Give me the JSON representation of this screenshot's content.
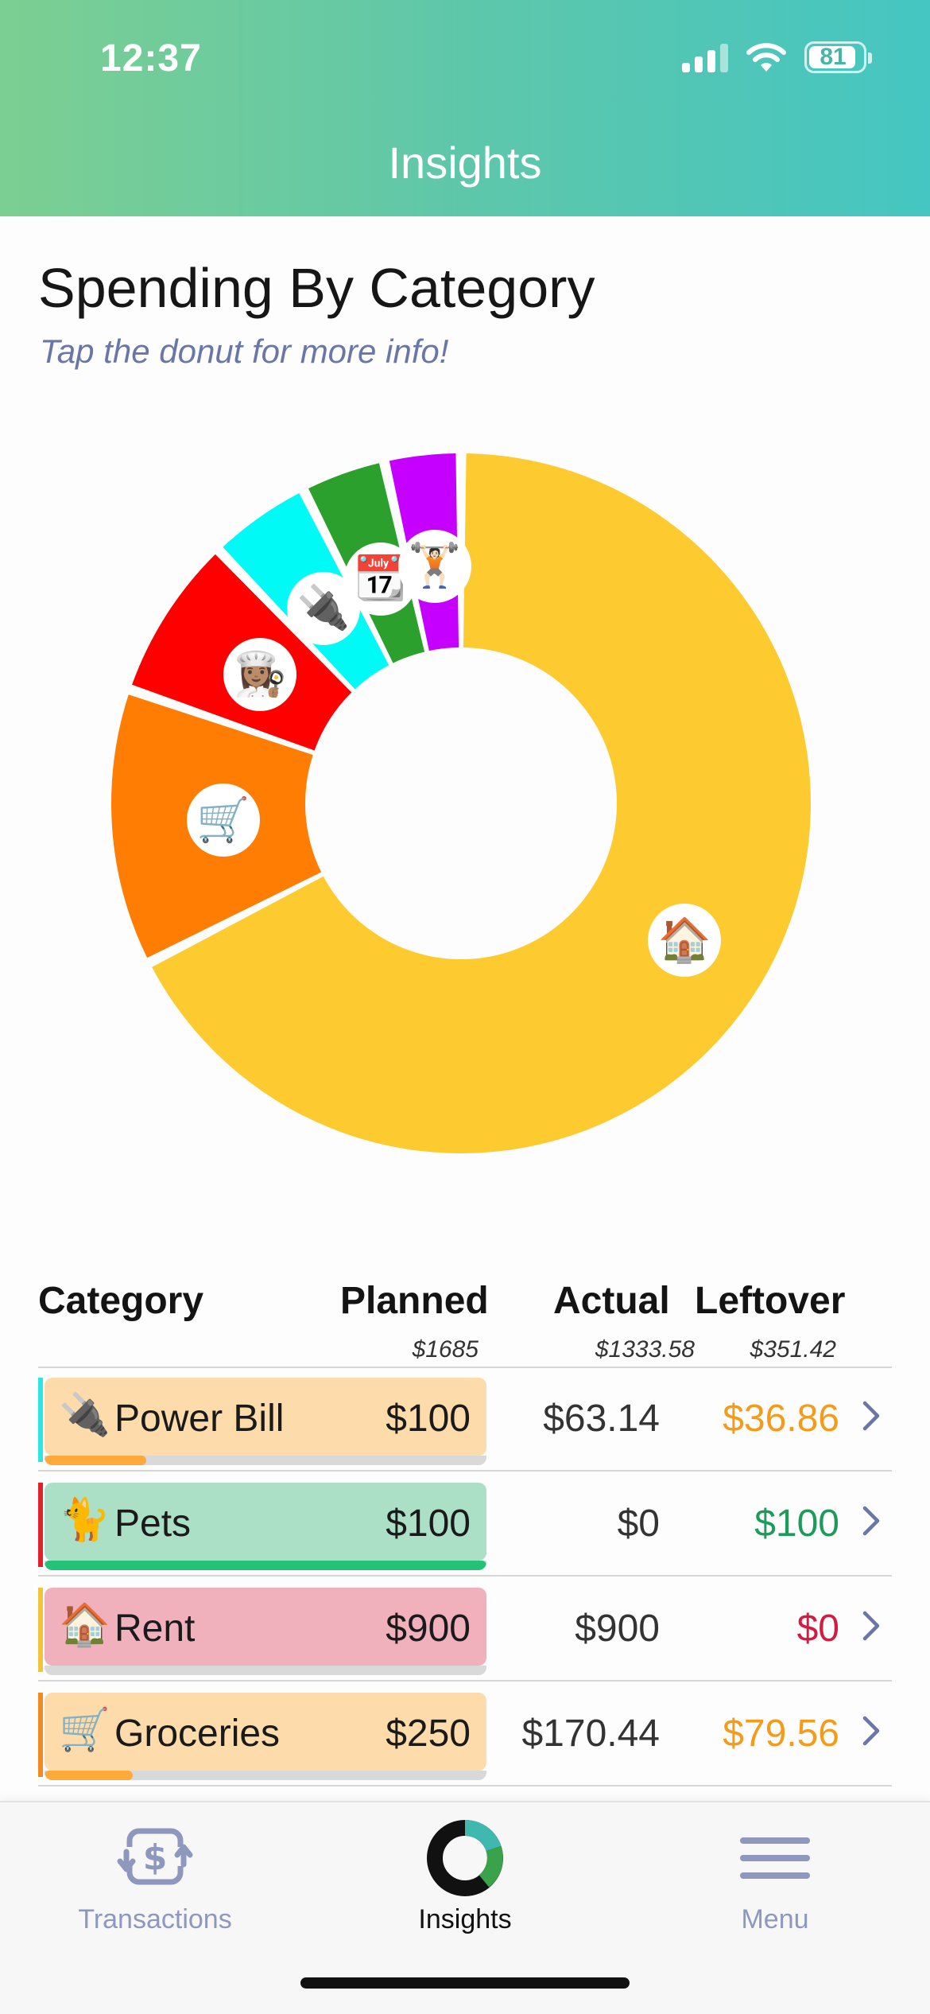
{
  "status_bar": {
    "time": "12:37",
    "battery": "81"
  },
  "nav": {
    "title": "Insights"
  },
  "section": {
    "title": "Spending By Category",
    "subtitle": "Tap the donut for more info!"
  },
  "chart_data": {
    "type": "pie",
    "donut": true,
    "slices": [
      {
        "label": "Rent",
        "value": 900,
        "color": "#fdcb2f",
        "icon": "house-icon",
        "emoji": "🏠"
      },
      {
        "label": "Groceries",
        "value": 170.44,
        "color": "#fe7d02",
        "icon": "shopping-cart-icon",
        "emoji": "🛒"
      },
      {
        "label": "Restaurants",
        "value": 101,
        "color": "#fe0000",
        "icon": "chef-icon",
        "emoji": "👩🏽‍🍳"
      },
      {
        "label": "Power Bill",
        "value": 63.14,
        "color": "#00fbf6",
        "icon": "electric-plug-icon",
        "emoji": "🔌"
      },
      {
        "label": "Subscriptions",
        "value": 52,
        "color": "#2ca02c",
        "icon": "calendar-icon",
        "emoji": "📆"
      },
      {
        "label": "Gym",
        "value": 47,
        "color": "#c600ff",
        "icon": "weightlifter-icon",
        "emoji": "🏋🏻"
      }
    ]
  },
  "table": {
    "headers": {
      "category": "Category",
      "planned": "Planned",
      "actual": "Actual",
      "leftover": "Leftover"
    },
    "totals": {
      "planned": "$1685",
      "actual": "$1333.58",
      "leftover": "$351.42"
    },
    "rows": [
      {
        "emoji": "🔌",
        "icon": "electric-plug-icon",
        "name": "Power Bill",
        "planned": "$100",
        "actual": "$63.14",
        "leftover": "$36.86",
        "accent": "#2ee6e0",
        "pill": "#fddbaa",
        "progress": 0.23,
        "progress_color": "#fdaa3a",
        "leftover_color": "#f39c1b"
      },
      {
        "emoji": "🐈",
        "icon": "cat-icon",
        "name": "Pets",
        "planned": "$100",
        "actual": "$0",
        "leftover": "$100",
        "accent": "#e0202a",
        "pill": "#abdfc6",
        "progress": 1.0,
        "progress_color": "#23c277",
        "leftover_color": "#1e9a5a"
      },
      {
        "emoji": "🏠",
        "icon": "house-icon",
        "name": "Rent",
        "planned": "$900",
        "actual": "$900",
        "leftover": "$0",
        "accent": "#f3c33a",
        "pill": "#f0b0bc",
        "progress": 0.0,
        "progress_color": "#e04060",
        "leftover_color": "#d11d43"
      },
      {
        "emoji": "🛒",
        "icon": "shopping-cart-icon",
        "name": "Groceries",
        "planned": "$250",
        "actual": "$170.44",
        "leftover": "$79.56",
        "accent": "#f28a1f",
        "pill": "#fddbaa",
        "progress": 0.2,
        "progress_color": "#fdaa3a",
        "leftover_color": "#f39c1b"
      }
    ]
  },
  "tabbar": {
    "tabs": [
      {
        "label": "Transactions",
        "icon": "transactions-icon"
      },
      {
        "label": "Insights",
        "icon": "insights-donut-icon"
      },
      {
        "label": "Menu",
        "icon": "menu-icon"
      }
    ]
  }
}
